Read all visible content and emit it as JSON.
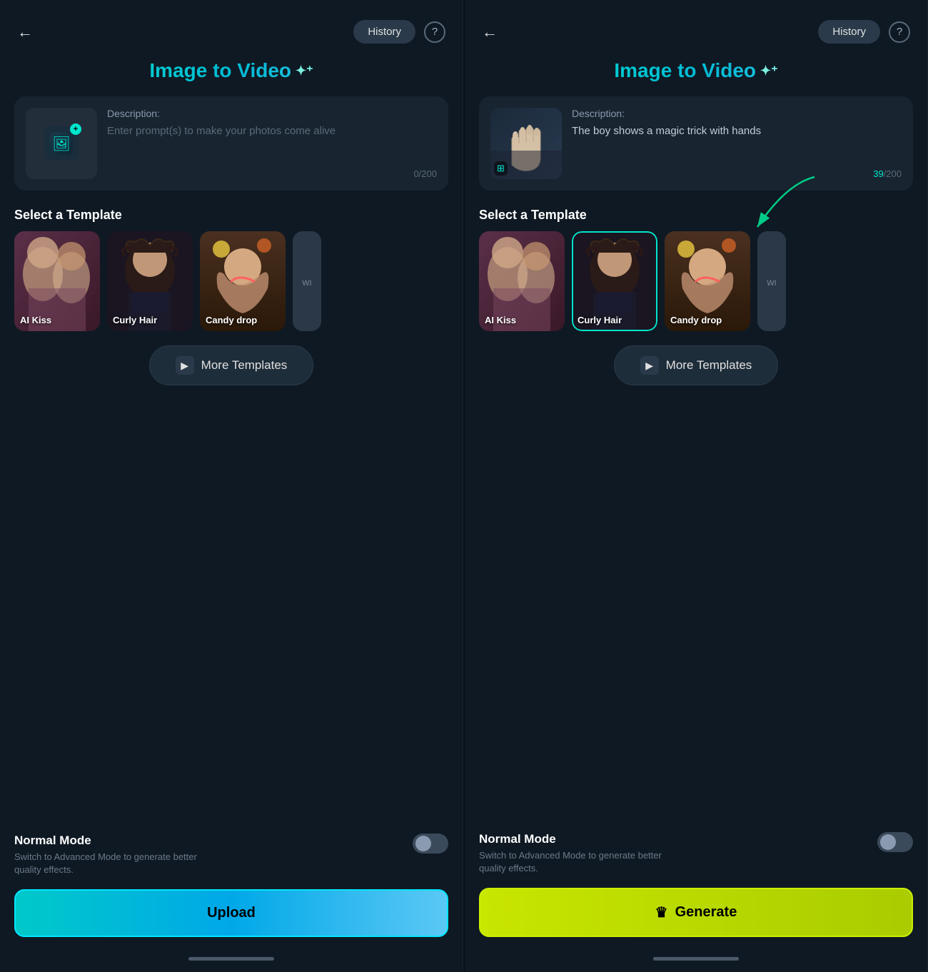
{
  "panels": [
    {
      "id": "left-panel",
      "backLabel": "←",
      "historyLabel": "History",
      "helpLabel": "?",
      "titleText": "Image to Video",
      "sparkleLabel": "✦⁺",
      "descLabel": "Description:",
      "descPlaceholder": "Enter prompt(s) to make your photos come alive",
      "descCounter": "0/200",
      "counterHighlight": false,
      "hasImage": false,
      "selectTemplateLabel": "Select a Template",
      "templates": [
        {
          "label": "AI Kiss",
          "gradient": [
            "#3a2030",
            "#5a3048",
            "#7a4060"
          ],
          "selected": false
        },
        {
          "label": "Curly Hair",
          "gradient": [
            "#1a1a2a",
            "#2a2a3a",
            "#1a1520"
          ],
          "selected": false
        },
        {
          "label": "Candy drop",
          "gradient": [
            "#3a2010",
            "#5a3820",
            "#7a4830"
          ],
          "selected": false
        }
      ],
      "moreTemplatesLabel": "More Templates",
      "modeTitle": "Normal Mode",
      "modeDesc": "Switch to Advanced Mode to generate better quality effects.",
      "actionLabel": "Upload",
      "actionType": "upload",
      "hasArrow": false
    },
    {
      "id": "right-panel",
      "backLabel": "←",
      "historyLabel": "History",
      "helpLabel": "?",
      "titleText": "Image to Video",
      "sparkleLabel": "✦⁺",
      "descLabel": "Description:",
      "descText": "The boy shows a magic trick with hands",
      "descCounter": "39/200",
      "counterHighlight": true,
      "hasImage": true,
      "selectTemplateLabel": "Select a Template",
      "templates": [
        {
          "label": "AI Kiss",
          "gradient": [
            "#3a2030",
            "#5a3048",
            "#7a4060"
          ],
          "selected": false
        },
        {
          "label": "Curly Hair",
          "gradient": [
            "#1a1a2a",
            "#2a2a3a",
            "#1a1520"
          ],
          "selected": true
        },
        {
          "label": "Candy drop",
          "gradient": [
            "#3a2010",
            "#5a3820",
            "#7a4830"
          ],
          "selected": false
        }
      ],
      "moreTemplatesLabel": "More Templates",
      "modeTitle": "Normal Mode",
      "modeDesc": "Switch to Advanced Mode to generate better quality effects.",
      "actionLabel": "Generate",
      "actionType": "generate",
      "crownIcon": "♛",
      "hasArrow": true
    }
  ]
}
